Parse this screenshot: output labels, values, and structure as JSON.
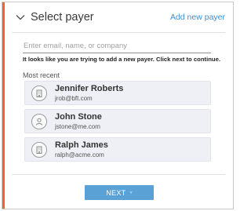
{
  "header": {
    "title": "Select payer",
    "add_link": "Add new payer"
  },
  "search": {
    "placeholder": "Enter email, name, or company",
    "value": ""
  },
  "hint": "It looks like you are trying to add a new payer. Click next to continue.",
  "recent": {
    "label": "Most recent",
    "payers": [
      {
        "name": "Jennifer Roberts",
        "email": "jrob@bft.com",
        "icon": "building-icon"
      },
      {
        "name": "John Stone",
        "email": "jstone@me.com",
        "icon": "person-icon"
      },
      {
        "name": "Ralph James",
        "email": "ralph@acme.com",
        "icon": "building-icon"
      }
    ]
  },
  "footer": {
    "next_label": "NEXT",
    "next_caret": "▿"
  },
  "colors": {
    "accent": "#f26522",
    "link": "#3d8fd4",
    "button": "#5aa2d6",
    "row_bg": "#eff0f5"
  }
}
